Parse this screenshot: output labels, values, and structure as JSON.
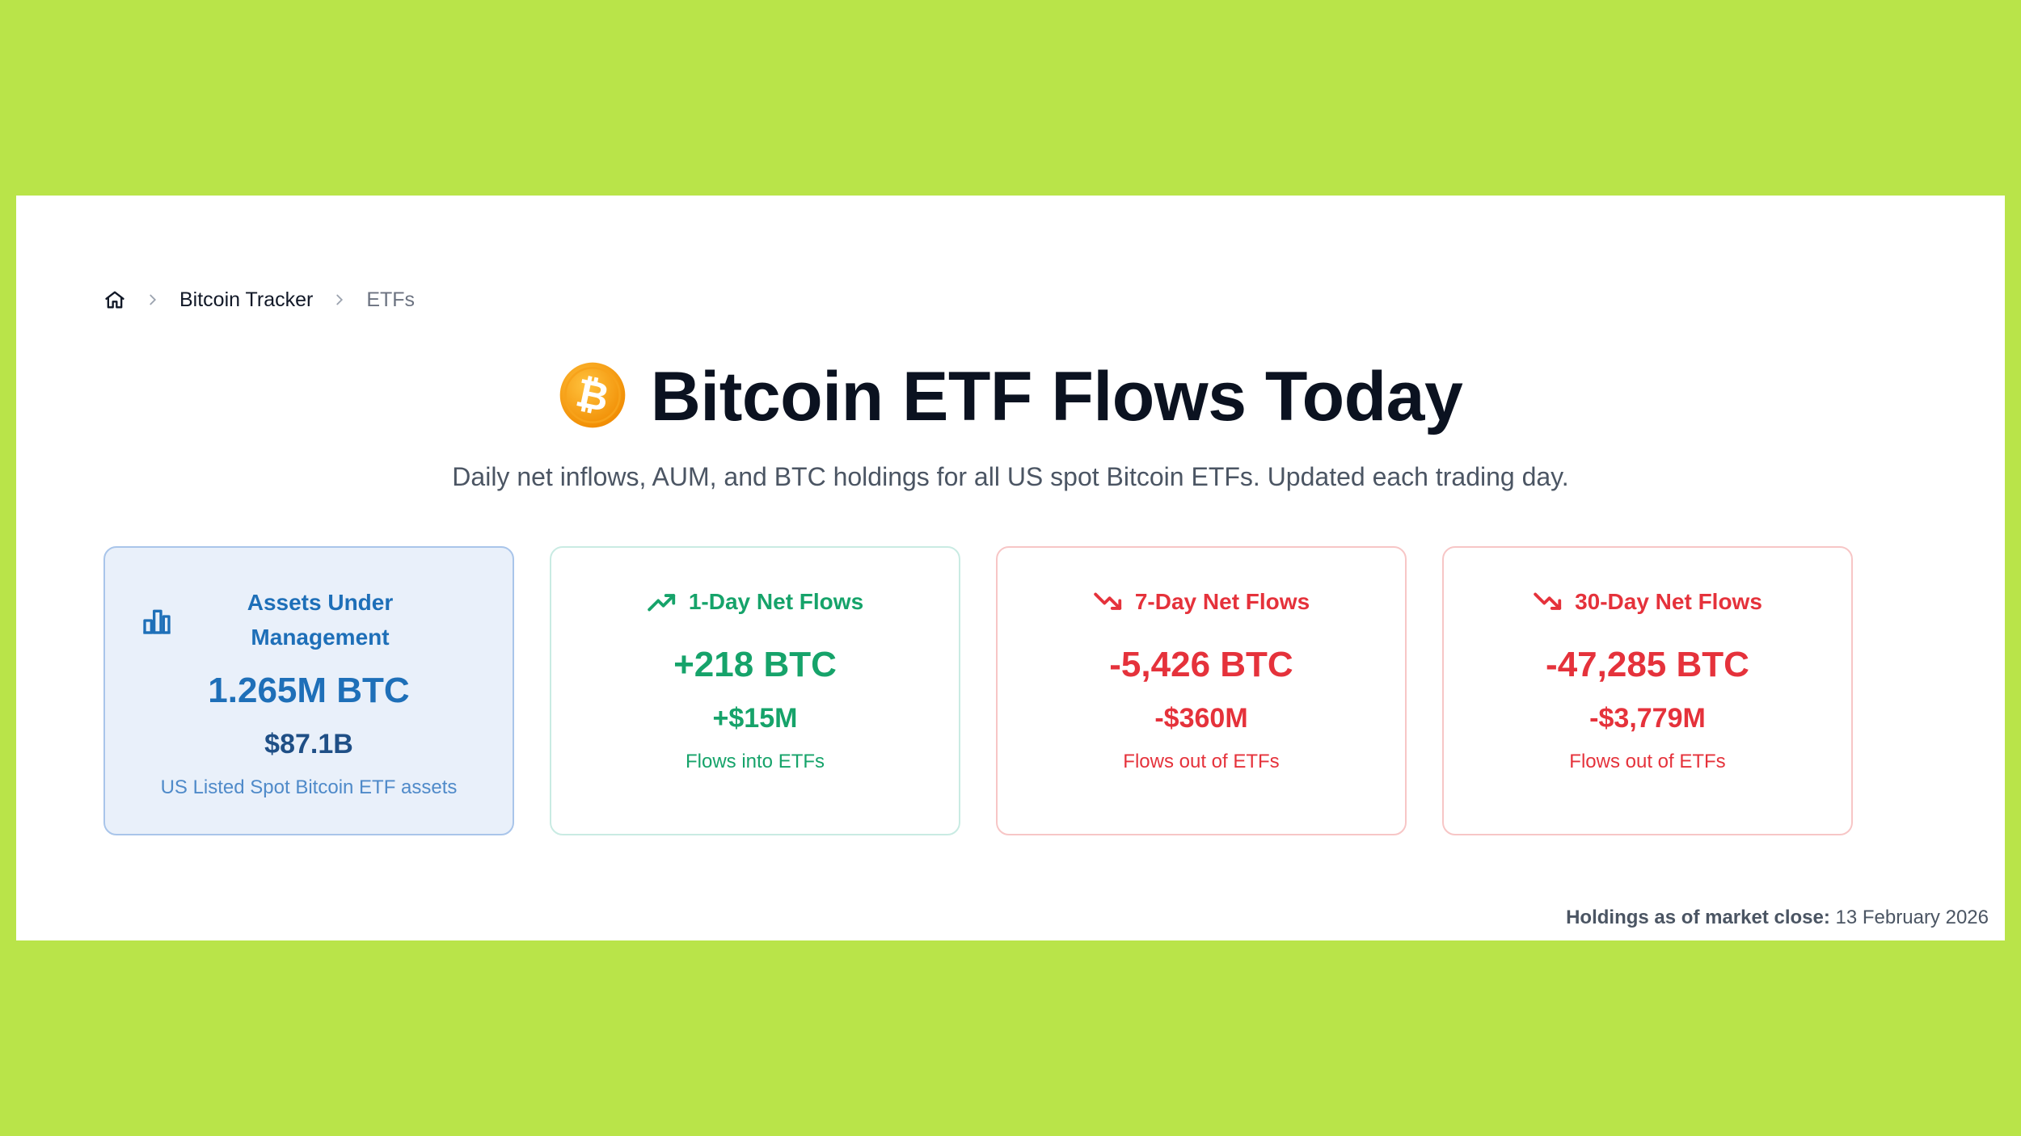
{
  "breadcrumb": {
    "home_icon": "home-icon",
    "items": [
      "Bitcoin Tracker",
      "ETFs"
    ]
  },
  "header": {
    "logo_icon": "bitcoin-logo-icon",
    "title": "Bitcoin ETF Flows Today",
    "subtitle": "Daily net inflows, AUM, and BTC holdings for all US spot Bitcoin ETFs. Updated each trading day."
  },
  "cards": {
    "aum": {
      "icon": "bar-chart-icon",
      "label": "Assets Under Management",
      "btc": "1.265M BTC",
      "usd": "$87.1B",
      "note": "US Listed Spot Bitcoin ETF assets"
    },
    "one_day": {
      "icon": "trending-up-icon",
      "label": "1-Day Net Flows",
      "btc": "+218 BTC",
      "usd": "+$15M",
      "note": "Flows into ETFs"
    },
    "seven_day": {
      "icon": "trending-down-icon",
      "label": "7-Day Net Flows",
      "btc": "-5,426 BTC",
      "usd": "-$360M",
      "note": "Flows out of ETFs"
    },
    "thirty_day": {
      "icon": "trending-down-icon",
      "label": "30-Day Net Flows",
      "btc": "-47,285 BTC",
      "usd": "-$3,779M",
      "note": "Flows out of ETFs"
    }
  },
  "footer": {
    "label": "Holdings as of market close:",
    "date": "13 February 2026"
  },
  "colors": {
    "background": "#b9e449",
    "positive": "#16a36a",
    "negative": "#e5323b",
    "aum_accent": "#1e6fb8",
    "bitcoin_orange": "#f7931a"
  }
}
